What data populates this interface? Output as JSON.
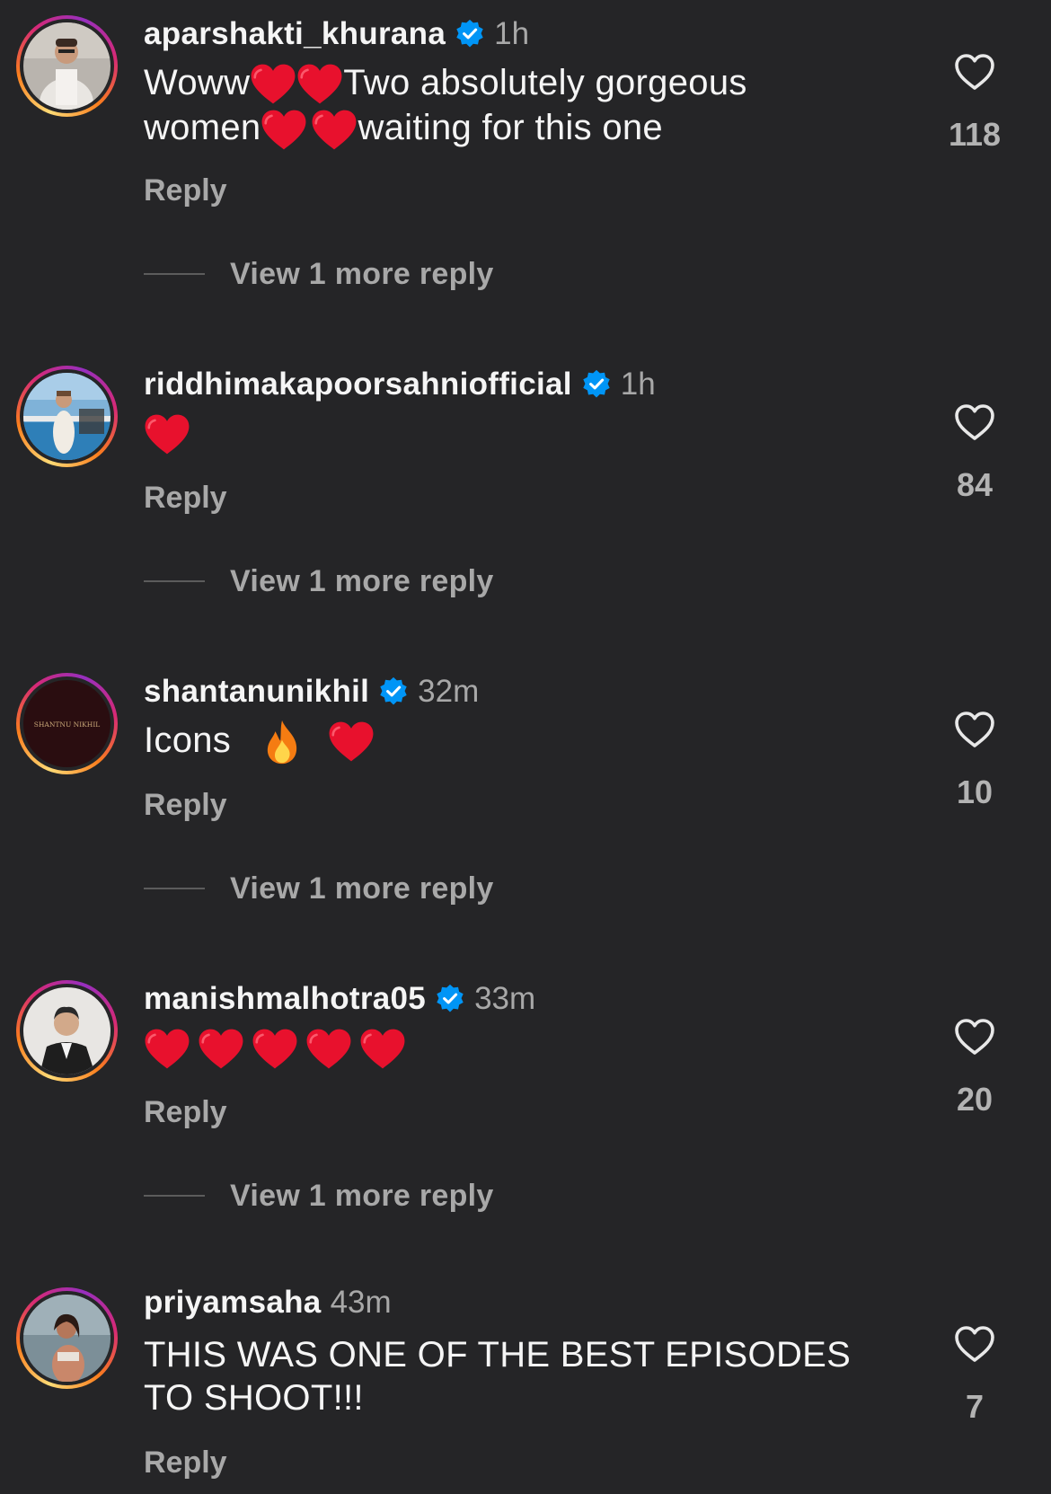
{
  "comments": [
    {
      "username": "aparshakti_khurana",
      "verified": true,
      "time": "1h",
      "text_parts": [
        "Woww",
        "Two absolutely gorgeous",
        "women",
        "waiting for this one"
      ],
      "emojis": [
        "red-heart",
        "red-heart",
        "red-heart",
        "red-heart"
      ],
      "reply_label": "Reply",
      "view_more_label": "View 1 more reply",
      "likes": "118"
    },
    {
      "username": "riddhimakapoorsahniofficial",
      "verified": true,
      "time": "1h",
      "emojis": [
        "red-heart"
      ],
      "reply_label": "Reply",
      "view_more_label": "View 1 more reply",
      "likes": "84"
    },
    {
      "username": "shantanunikhil",
      "verified": true,
      "time": "32m",
      "text": "Icons",
      "emojis": [
        "fire",
        "red-heart"
      ],
      "reply_label": "Reply",
      "view_more_label": "View 1 more reply",
      "likes": "10",
      "avatar_logo_text": "SHANTNU NIKHIL"
    },
    {
      "username": "manishmalhotra05",
      "verified": true,
      "time": "33m",
      "emojis": [
        "red-heart",
        "red-heart",
        "red-heart",
        "red-heart",
        "red-heart"
      ],
      "reply_label": "Reply",
      "view_more_label": "View 1 more reply",
      "likes": "20"
    },
    {
      "username": "priyamsaha",
      "verified": false,
      "time": "43m",
      "text": "THIS WAS ONE OF THE BEST EPISODES TO SHOOT!!!",
      "reply_label": "Reply",
      "likes": "7"
    }
  ],
  "icons": {
    "like": "heart-outline-icon",
    "verified": "verified-badge-icon",
    "emoji_heart": "red-heart-emoji",
    "emoji_fire": "fire-emoji"
  },
  "colors": {
    "background": "#252527",
    "text": "#f5f5f5",
    "secondary_text": "#a8a8a8",
    "verified_blue": "#0095f6",
    "heart_red": "#e8112d"
  }
}
